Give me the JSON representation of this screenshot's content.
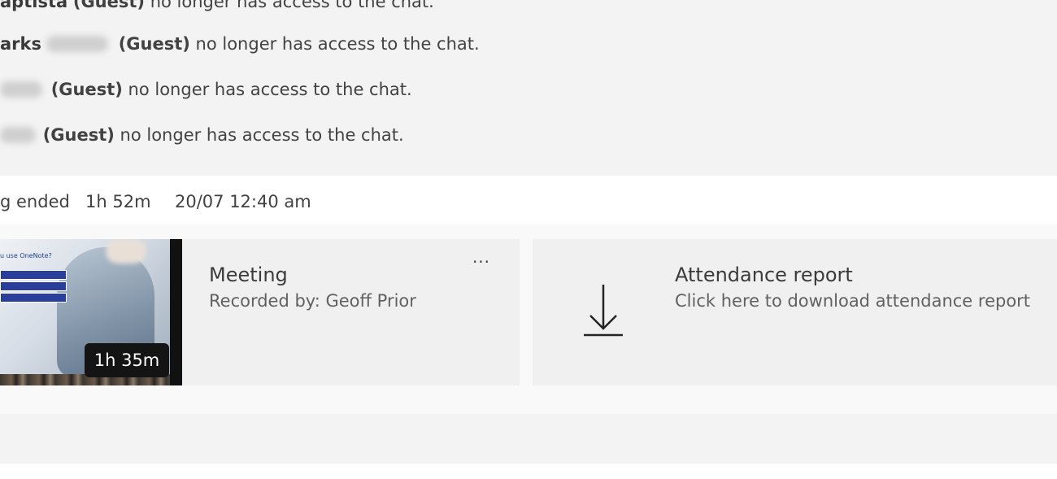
{
  "messages": [
    {
      "name": "aptista",
      "guest": "(Guest)",
      "text": " no longer has access to the chat."
    },
    {
      "name": "arks",
      "guest": "(Guest)",
      "text": " no longer has access to the chat."
    },
    {
      "name": "",
      "guest": "(Guest)",
      "text": " no longer has access to the chat."
    },
    {
      "name": "",
      "guest": "(Guest)",
      "text": " no longer has access to the chat."
    }
  ],
  "meeting_ended": {
    "label": "g ended",
    "duration": "1h 52m",
    "timestamp": "20/07 12:40 am"
  },
  "recording": {
    "title": "Meeting",
    "recorded_by": "Recorded by: Geoff Prior",
    "duration": "1h 35m",
    "more_label": "···",
    "thumbnail_text": "u use OneNote?"
  },
  "attendance": {
    "title": "Attendance report",
    "subtitle": "Click here to download attendance report",
    "icon": "download-icon"
  },
  "colors": {
    "chat_background": "#f3f3f3",
    "card_background": "#f0f0f0",
    "badge_background": "#141414"
  }
}
